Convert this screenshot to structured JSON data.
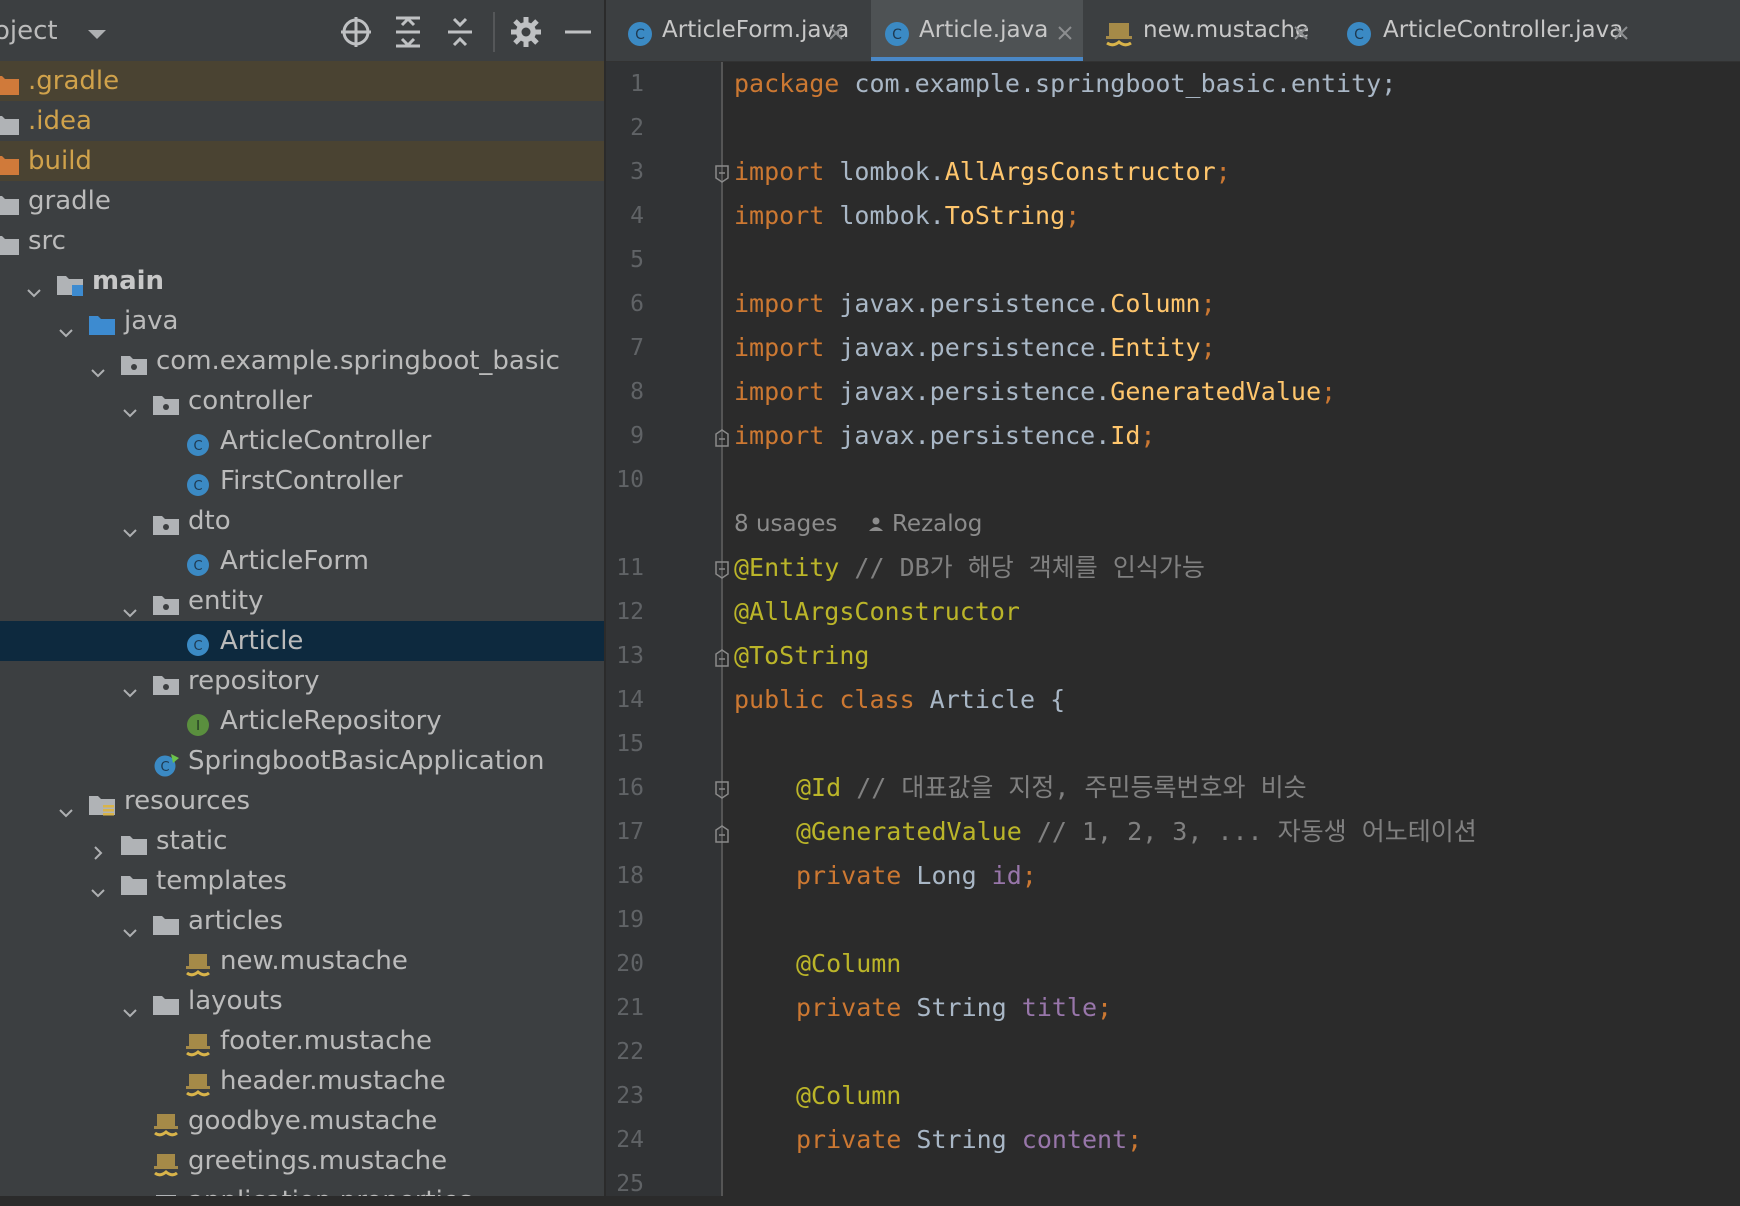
{
  "project_panel": {
    "title": "oject",
    "tools": [
      "locate-icon",
      "expand-all-icon",
      "collapse-all-icon",
      "settings-icon",
      "hide-icon"
    ],
    "tree": [
      {
        "label": ".gradle",
        "icon": "folder-excluded",
        "style": "ignored"
      },
      {
        "label": ".idea",
        "icon": "folder",
        "style": "ignored-plain"
      },
      {
        "label": "build",
        "icon": "folder-excluded",
        "style": "ignored"
      },
      {
        "label": "gradle",
        "icon": "folder"
      },
      {
        "label": "src",
        "icon": "folder"
      },
      {
        "label": "main",
        "icon": "folder-module",
        "expanded": true,
        "bold": true
      },
      {
        "label": "java",
        "icon": "folder-source",
        "expanded": true
      },
      {
        "label": "com.example.springboot_basic",
        "icon": "package",
        "expanded": true
      },
      {
        "label": "controller",
        "icon": "package",
        "expanded": true
      },
      {
        "label": "ArticleController",
        "icon": "class"
      },
      {
        "label": "FirstController",
        "icon": "class"
      },
      {
        "label": "dto",
        "icon": "package",
        "expanded": true
      },
      {
        "label": "ArticleForm",
        "icon": "class"
      },
      {
        "label": "entity",
        "icon": "package",
        "expanded": true
      },
      {
        "label": "Article",
        "icon": "class",
        "selected": true
      },
      {
        "label": "repository",
        "icon": "package",
        "expanded": true
      },
      {
        "label": "ArticleRepository",
        "icon": "interface"
      },
      {
        "label": "SpringbootBasicApplication",
        "icon": "spring-class"
      },
      {
        "label": "resources",
        "icon": "folder-resources",
        "expanded": true
      },
      {
        "label": "static",
        "icon": "folder",
        "expanded": false
      },
      {
        "label": "templates",
        "icon": "folder",
        "expanded": true
      },
      {
        "label": "articles",
        "icon": "folder",
        "expanded": true
      },
      {
        "label": "new.mustache",
        "icon": "mustache"
      },
      {
        "label": "layouts",
        "icon": "folder",
        "expanded": true
      },
      {
        "label": "footer.mustache",
        "icon": "mustache"
      },
      {
        "label": "header.mustache",
        "icon": "mustache"
      },
      {
        "label": "goodbye.mustache",
        "icon": "mustache"
      },
      {
        "label": "greetings.mustache",
        "icon": "mustache"
      },
      {
        "label": "application.properties",
        "icon": "properties"
      }
    ]
  },
  "tabs": [
    {
      "label": "ArticleForm.java",
      "icon": "class-icon"
    },
    {
      "label": "Article.java",
      "icon": "class-icon",
      "active": true
    },
    {
      "label": "new.mustache",
      "icon": "mustache-icon"
    },
    {
      "label": "ArticleController.java",
      "icon": "class-icon"
    }
  ],
  "editor": {
    "line_numbers": [
      "1",
      "2",
      "3",
      "4",
      "5",
      "6",
      "7",
      "8",
      "9",
      "10",
      "11",
      "12",
      "13",
      "14",
      "15",
      "16",
      "17",
      "18",
      "19",
      "20",
      "21",
      "22",
      "23",
      "24",
      "25"
    ],
    "inlay": {
      "usages": "8 usages",
      "author": "Rezalog"
    },
    "code": {
      "l1": {
        "kw": "package",
        "rest": " com.example.springboot_basic.entity;"
      },
      "l3": {
        "kw": "import",
        "pkg": " lombok.",
        "cls": "AllArgsConstructor",
        "semi": ";"
      },
      "l4": {
        "kw": "import",
        "pkg": " lombok.",
        "cls": "ToString",
        "semi": ";"
      },
      "l6": {
        "kw": "import",
        "pkg": " javax.persistence.",
        "cls": "Column",
        "semi": ";"
      },
      "l7": {
        "kw": "import",
        "pkg": " javax.persistence.",
        "cls": "Entity",
        "semi": ";"
      },
      "l8": {
        "kw": "import",
        "pkg": " javax.persistence.",
        "cls": "GeneratedValue",
        "semi": ";"
      },
      "l9": {
        "kw": "import",
        "pkg": " javax.persistence.",
        "cls": "Id",
        "semi": ";"
      },
      "l11": {
        "an": "@Entity",
        "cm": " // DB가 해당 객체를 인식가능"
      },
      "l12": {
        "an": "@AllArgsConstructor"
      },
      "l13": {
        "an": "@ToString"
      },
      "l14": {
        "kw": "public class",
        "rest": " Article {"
      },
      "l16": {
        "an": "@Id",
        "cm": " // 대표값을 지정, 주민등록번호와 비슷"
      },
      "l17": {
        "an": "@GeneratedValue",
        "cm": " // 1, 2, 3, ... 자동생 어노테이션"
      },
      "l18": {
        "kw": "private",
        "type": " Long ",
        "fd": "id",
        "semi": ";"
      },
      "l20": {
        "an": "@Column"
      },
      "l21": {
        "kw": "private",
        "type": " String ",
        "fd": "title",
        "semi": ";"
      },
      "l23": {
        "an": "@Column"
      },
      "l24": {
        "kw": "private",
        "type": " String ",
        "fd": "content",
        "semi": ";"
      }
    }
  },
  "colors": {
    "panel_bg": "#3c3f41",
    "editor_bg": "#2b2b2b",
    "selection": "#0d293e",
    "ignored_row": "#4a4332",
    "keyword": "#cc7832",
    "annotation": "#bbb529",
    "comment": "#808080",
    "field": "#9876aa",
    "accent": "#4a88c7"
  }
}
